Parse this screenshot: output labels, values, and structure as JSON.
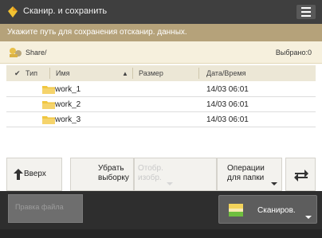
{
  "window": {
    "title": "Сканир. и сохранить"
  },
  "hint": "Укажите путь для сохранения отсканир. данных.",
  "path_bar": {
    "path": "Share/",
    "selected_label": "Выбрано:0"
  },
  "table": {
    "headers": {
      "check": "✔",
      "type": "Тип",
      "name": "Имя",
      "sort_icon": "▲",
      "size": "Размер",
      "date": "Дата/Время"
    },
    "rows": [
      {
        "name": "work_1",
        "date": "14/03  06:01"
      },
      {
        "name": "work_2",
        "date": "14/03  06:01"
      },
      {
        "name": "work_3",
        "date": "14/03  06:01"
      }
    ]
  },
  "toolbar": {
    "up": "Вверх",
    "clear_selection_1": "Убрать",
    "clear_selection_2": "выборку",
    "view_1": "Отобр.",
    "view_2": "изобр.",
    "folder_ops_1": "Операции",
    "folder_ops_2": "для папки"
  },
  "footer": {
    "edit_file": "Правка файла",
    "scan": "Сканиров."
  },
  "colors": {
    "accent": "#b5a27a",
    "folder": "#f0c63f",
    "title_bg": "#3f3f3f"
  },
  "icons": [
    "scanner-icon",
    "menu-icon",
    "network-share-icon",
    "folder-icon",
    "up-arrow-icon",
    "refresh-icon",
    "scan-icon"
  ]
}
